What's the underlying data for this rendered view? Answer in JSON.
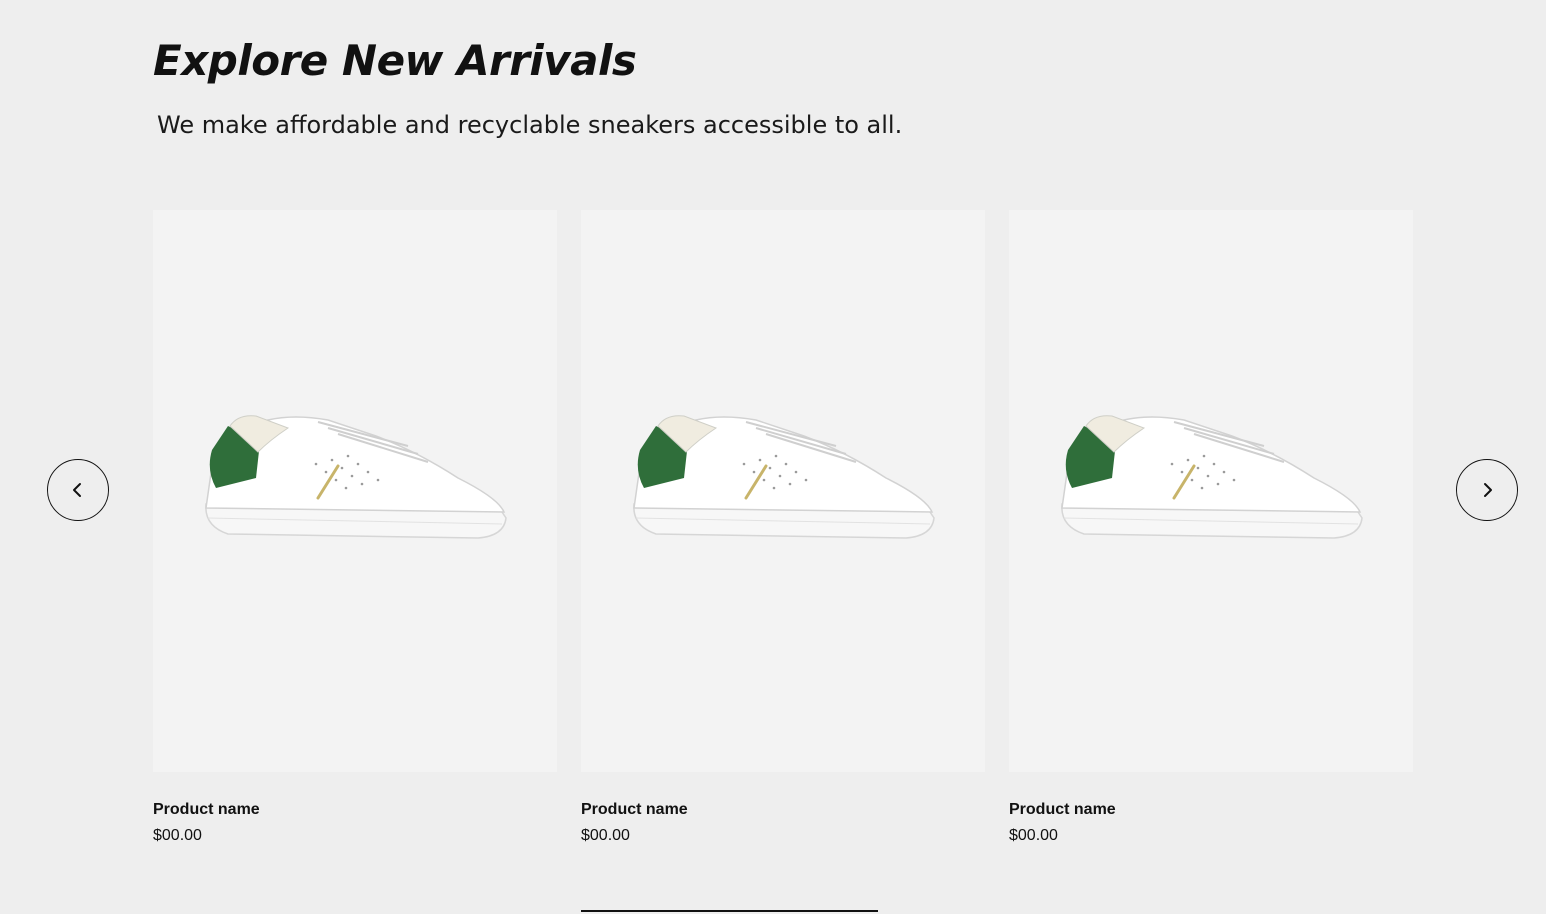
{
  "section": {
    "title": "Explore New Arrivals",
    "subtitle": "We make affordable and recyclable sneakers accessible to all."
  },
  "carousel": {
    "prev_icon": "chevron-left-icon",
    "next_icon": "chevron-right-icon",
    "products": [
      {
        "name": "Product name",
        "price": "$00.00",
        "image": "white-green-sneaker"
      },
      {
        "name": "Product name",
        "price": "$00.00",
        "image": "white-green-sneaker"
      },
      {
        "name": "Product name",
        "price": "$00.00",
        "image": "white-green-sneaker"
      }
    ]
  },
  "colors": {
    "background": "#eeeeee",
    "card_background": "#f3f3f3",
    "text": "#111111",
    "sneaker_accent": "#2f6e3a"
  }
}
